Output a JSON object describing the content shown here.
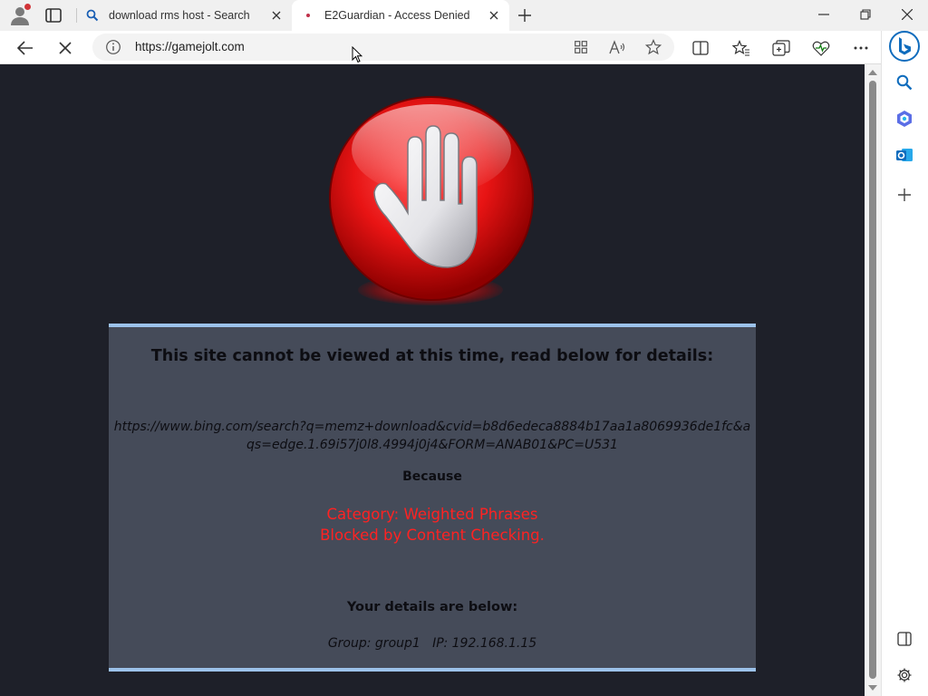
{
  "browser": {
    "tabs": [
      {
        "label": "download rms host - Search",
        "favicon": "search-icon",
        "active": false
      },
      {
        "label": "E2Guardian - Access Denied",
        "favicon": "dot-icon",
        "active": true
      }
    ],
    "address": {
      "url": "https://gamejolt.com"
    },
    "colors": {
      "accent": "#0f6cbd",
      "tabstrip": "#f0f0f0"
    }
  },
  "page": {
    "heading": "This site cannot be viewed at this time, read below for details:",
    "blocked_url": "https://www.bing.com/search?q=memz+download&cvid=b8d6edeca8884b17aa1a8069936de1fc&aqs=edge.1.69i57j0l8.4994j0j4&FORM=ANAB01&PC=U531",
    "because_label": "Because",
    "reason_line1": "Category: Weighted Phrases",
    "reason_line2": "Blocked by Content Checking.",
    "details_heading": "Your details are below:",
    "details": "Group: group1   IP: 192.168.1.15",
    "colors": {
      "background": "#1e2029",
      "panel": "#454b59",
      "panel_border": "#9cc2ea",
      "reason": "#ff2222"
    }
  }
}
